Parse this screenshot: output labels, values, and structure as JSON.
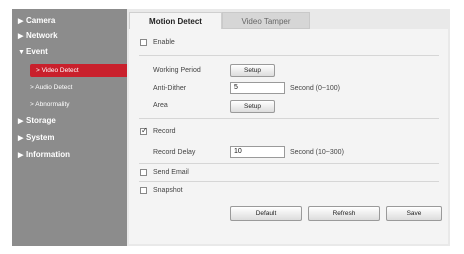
{
  "sidebar": {
    "items": [
      {
        "label": "Camera",
        "arrow": "▶"
      },
      {
        "label": "Network",
        "arrow": "▶"
      },
      {
        "label": "Event",
        "arrow": "▼"
      },
      {
        "label": "Storage",
        "arrow": "▶"
      },
      {
        "label": "System",
        "arrow": "▶"
      },
      {
        "label": "Information",
        "arrow": "▶"
      }
    ],
    "event_sub": [
      {
        "label": "> Video Detect",
        "active": true
      },
      {
        "label": "> Audio Detect",
        "active": false
      },
      {
        "label": "> Abnormality",
        "active": false
      }
    ]
  },
  "tabs": [
    {
      "label": "Motion Detect",
      "active": true
    },
    {
      "label": "Video Tamper",
      "active": false
    }
  ],
  "form": {
    "enable_label": "Enable",
    "enable_checked": false,
    "working_period_label": "Working Period",
    "setup_label": "Setup",
    "anti_dither_label": "Anti-Dither",
    "anti_dither_value": "5",
    "anti_dither_unit": "Second (0~100)",
    "area_label": "Area",
    "area_setup_label": "Setup",
    "record_label": "Record",
    "record_checked": true,
    "record_delay_label": "Record Delay",
    "record_delay_value": "10",
    "record_delay_unit": "Second (10~300)",
    "send_email_label": "Send Email",
    "snapshot_label": "Snapshot"
  },
  "buttons": {
    "default_label": "Default",
    "refresh_label": "Refresh",
    "save_label": "Save"
  },
  "colors": {
    "active_red": "#c9202c",
    "sidebar_bg": "#8c8c8c"
  }
}
